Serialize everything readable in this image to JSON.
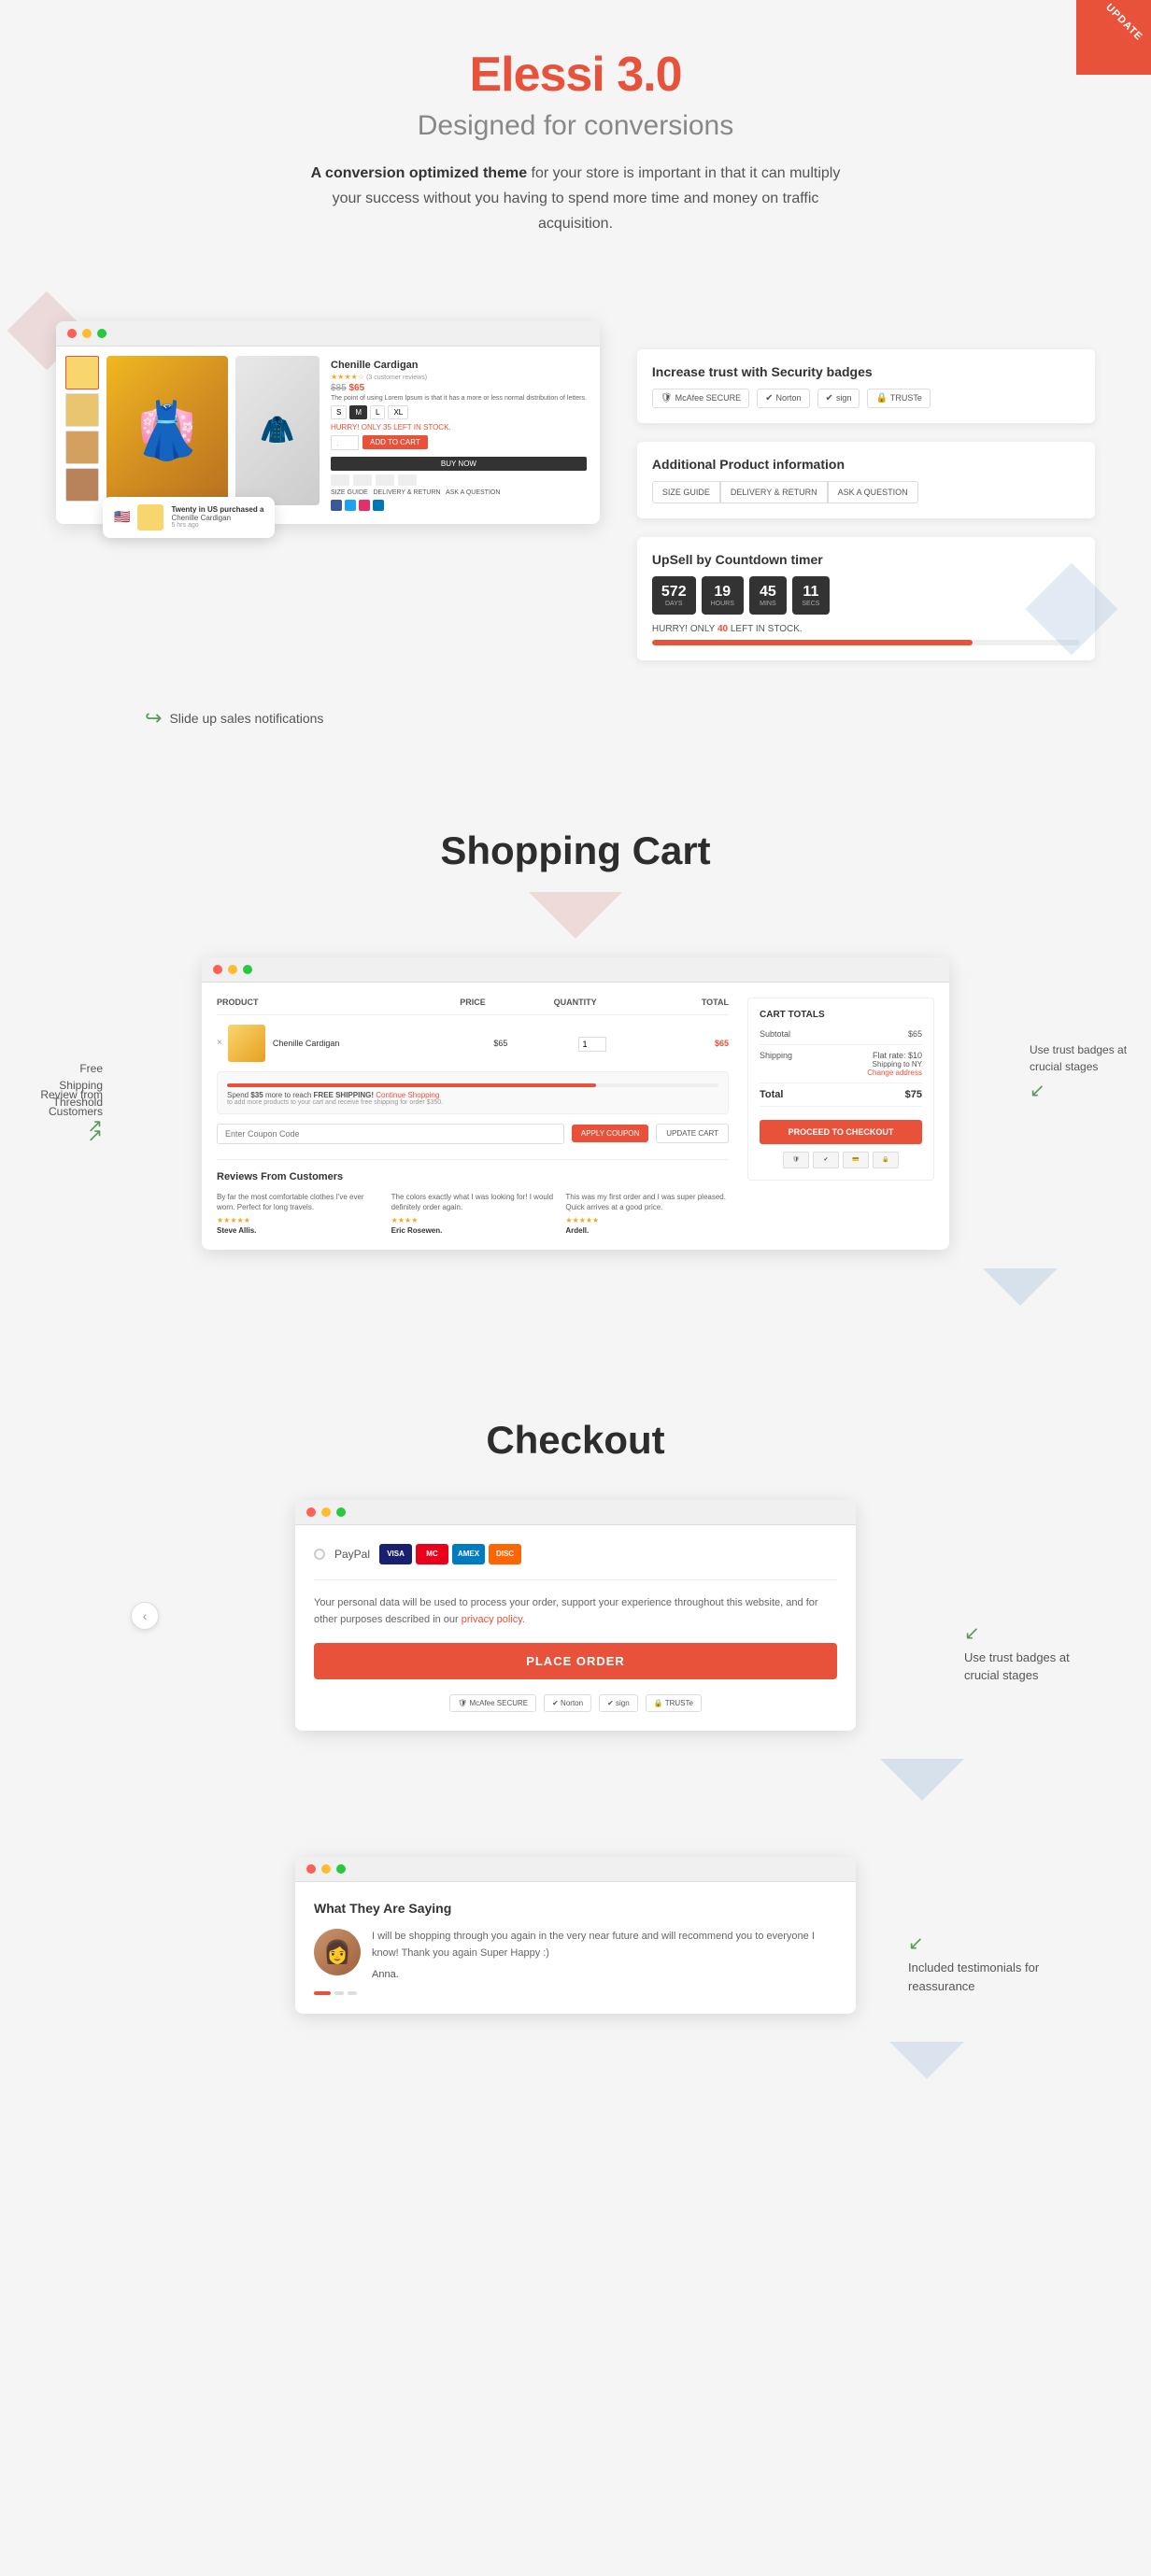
{
  "meta": {
    "update_badge": "UPDATE"
  },
  "hero": {
    "title_main": "Elessi",
    "title_version": "3.0",
    "subtitle": "Designed for conversions",
    "description_bold": "A conversion optimized theme",
    "description_rest": " for your store is important in that it can multiply your success without you having to spend more time and money on traffic acquisition."
  },
  "product_section": {
    "product_name": "Chenille Cardigan",
    "product_reviews": "(3 customer reviews)",
    "price_old": "$85",
    "price_new": "$65",
    "stock_msg": "HURRY! ONLY 35 LEFT IN STOCK.",
    "size_options": [
      "S",
      "M",
      "L",
      "XL"
    ],
    "selected_size": "M",
    "add_cart": "ADD TO CART",
    "buy_now": "BUY NOW",
    "delivery_tabs": [
      "SIZE GUIDE",
      "DELIVERY & RETURN",
      "ASK A QUESTION"
    ],
    "security_title": "Increase trust with Security badges",
    "security_badges": [
      {
        "label": "McAfee SECURE"
      },
      {
        "label": "Norton"
      },
      {
        "label": "✔ sign"
      },
      {
        "label": "TRUSTe"
      }
    ],
    "product_info_title": "Additional Product information",
    "upsell_title": "UpSell by Countdown timer",
    "countdown": {
      "days_val": "572",
      "days_label": "DAYS",
      "hours_val": "19",
      "hours_label": "HOURS",
      "mins_val": "45",
      "mins_label": "MINS",
      "secs_val": "11",
      "secs_label": "SECS"
    },
    "hurry_text": "HURRY! ONLY",
    "hurry_num": "40",
    "hurry_end": "LEFT IN STOCK.",
    "slide_up_label": "Slide up sales notifications"
  },
  "notification": {
    "name": "Twenty in US purchased a",
    "product": "Chenille Cardigan",
    "time": "5 hrs ago"
  },
  "shopping_cart": {
    "section_title": "Shopping Cart",
    "headers": [
      "PRODUCT",
      "PRICE",
      "QUANTITY",
      "TOTAL"
    ],
    "item_name": "Chenille Cardigan",
    "item_price": "$65",
    "item_qty": "1",
    "item_total": "$65",
    "progress_pct": "75",
    "progress_text": "Spend $35 more to reach FREE SHIPPING! Continue Shopping",
    "free_shipping_note": "to add more products to your cart and receive free shipping for order $350.",
    "coupon_placeholder": "Enter Coupon Code",
    "apply_coupon_label": "APPLY COUPON",
    "update_cart_label": "UPDATE CART",
    "reviews_title": "Reviews From Customers",
    "reviews": [
      {
        "text": "By far the most comfortable clothes I've ever worn. Perfect for long travels.",
        "stars": "★★★★★",
        "author": "Steve Allis."
      },
      {
        "text": "The colors exactly what I was looking for! I would definitely order again.",
        "stars": "★★★★",
        "author": "Eric Rosewen."
      },
      {
        "text": "This was my first order and I was super pleased. Quick arrives at a good price.",
        "stars": "★★★★★",
        "author": "Ardell."
      }
    ],
    "totals": {
      "title": "CART TOTALS",
      "subtotal_label": "Subtotal",
      "subtotal_val": "$65",
      "shipping_label": "Shipping",
      "shipping_val": "Flat rate: $10",
      "shipping_note": "Shipping to NY",
      "change_address": "Change address",
      "total_label": "Total",
      "total_val": "$75",
      "checkout_btn": "PROCEED TO CHECKOUT"
    },
    "annotations": {
      "left_free_shipping": "Free Shipping Threshold",
      "left_review": "Review from Customers",
      "right_trust": "Use trust badges at crucial stages"
    }
  },
  "checkout": {
    "section_title": "Checkout",
    "payment_label": "PayPal",
    "payment_icons": [
      "VISA",
      "MC",
      "AMEX",
      "DISC"
    ],
    "description": "Your personal data will be used to process your order, support your experience throughout this website, and for other purposes described in our ",
    "privacy_link": "privacy policy.",
    "place_order_btn": "PLACE ORDER",
    "trust_badges": [
      "McAfee SECURE",
      "Norton",
      "✔ sign",
      "TRUSTe"
    ],
    "right_annotation": "Use trust badges at crucial stages"
  },
  "testimonial": {
    "section_title": "What They Are Saying",
    "text": "I will be shopping through you again in the very near future and will recommend you to everyone I know! Thank you again Super Happy :)",
    "author": "Anna.",
    "annotation": "Included testimonials for reassurance"
  }
}
